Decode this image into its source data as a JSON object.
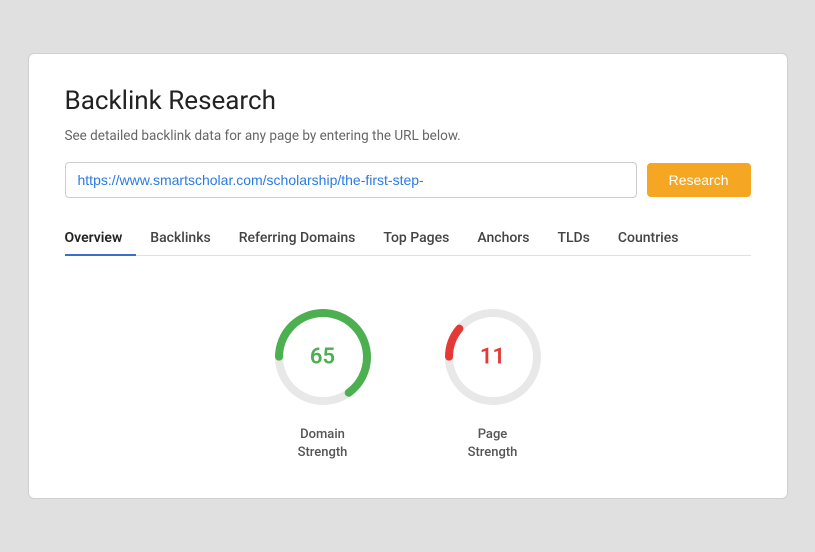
{
  "page": {
    "title": "Backlink Research",
    "subtitle": "See detailed backlink data for any page by entering the URL below.",
    "url_value": "https://www.smartscholar.com/scholarship/the-first-step-",
    "url_placeholder": "Enter URL",
    "research_button": "Research"
  },
  "tabs": [
    {
      "id": "overview",
      "label": "Overview",
      "active": true
    },
    {
      "id": "backlinks",
      "label": "Backlinks",
      "active": false
    },
    {
      "id": "referring-domains",
      "label": "Referring Domains",
      "active": false
    },
    {
      "id": "top-pages",
      "label": "Top Pages",
      "active": false
    },
    {
      "id": "anchors",
      "label": "Anchors",
      "active": false
    },
    {
      "id": "tlds",
      "label": "TLDs",
      "active": false
    },
    {
      "id": "countries",
      "label": "Countries",
      "active": false
    }
  ],
  "metrics": [
    {
      "id": "domain-strength",
      "value": "65",
      "label": "Domain\nStrength",
      "color": "green",
      "percent": 65
    },
    {
      "id": "page-strength",
      "value": "11",
      "label": "Page\nStrength",
      "color": "red",
      "percent": 11
    }
  ]
}
